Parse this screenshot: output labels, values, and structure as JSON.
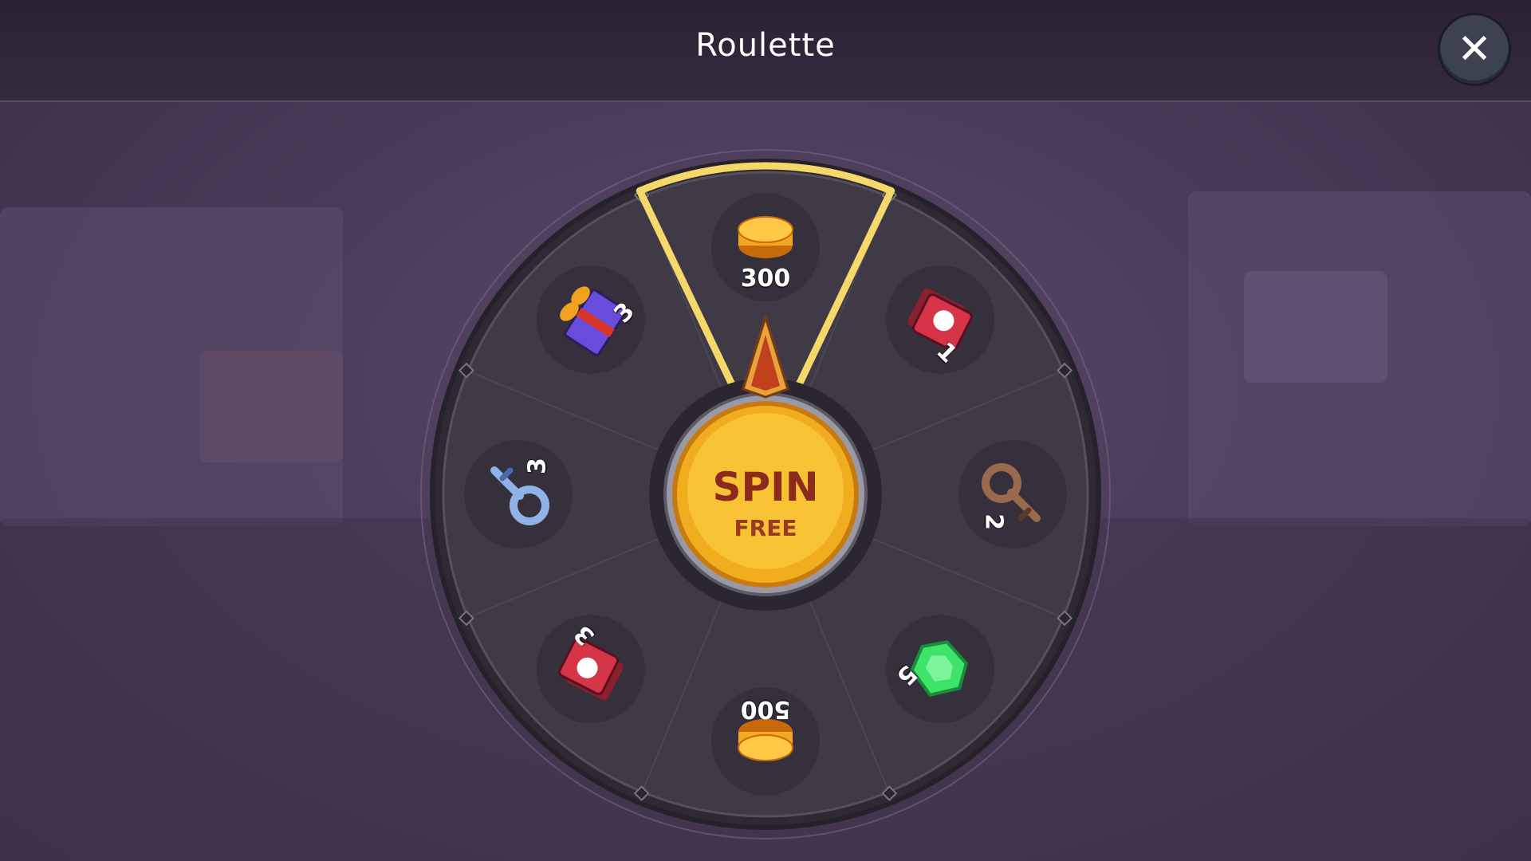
{
  "header": {
    "title": "Roulette"
  },
  "close_button": {
    "icon": "close-icon",
    "glyph": "✕"
  },
  "spin_button": {
    "main_label": "SPIN",
    "sub_label": "FREE"
  },
  "wheel": {
    "selected_index": 0,
    "segments": [
      {
        "item": "gold-coins",
        "quantity": "300"
      },
      {
        "item": "red-ticket",
        "quantity": "1"
      },
      {
        "item": "bronze-key",
        "quantity": "2"
      },
      {
        "item": "green-gem",
        "quantity": "5"
      },
      {
        "item": "gold-coins",
        "quantity": "500"
      },
      {
        "item": "red-ticket",
        "quantity": "3"
      },
      {
        "item": "silver-key",
        "quantity": "3"
      },
      {
        "item": "gift-box",
        "quantity": "3"
      }
    ]
  },
  "colors": {
    "gold": "#f5b524",
    "highlight": "#f4d86a",
    "wheel_face": "#3f3945",
    "slot_circle": "#35303b"
  }
}
